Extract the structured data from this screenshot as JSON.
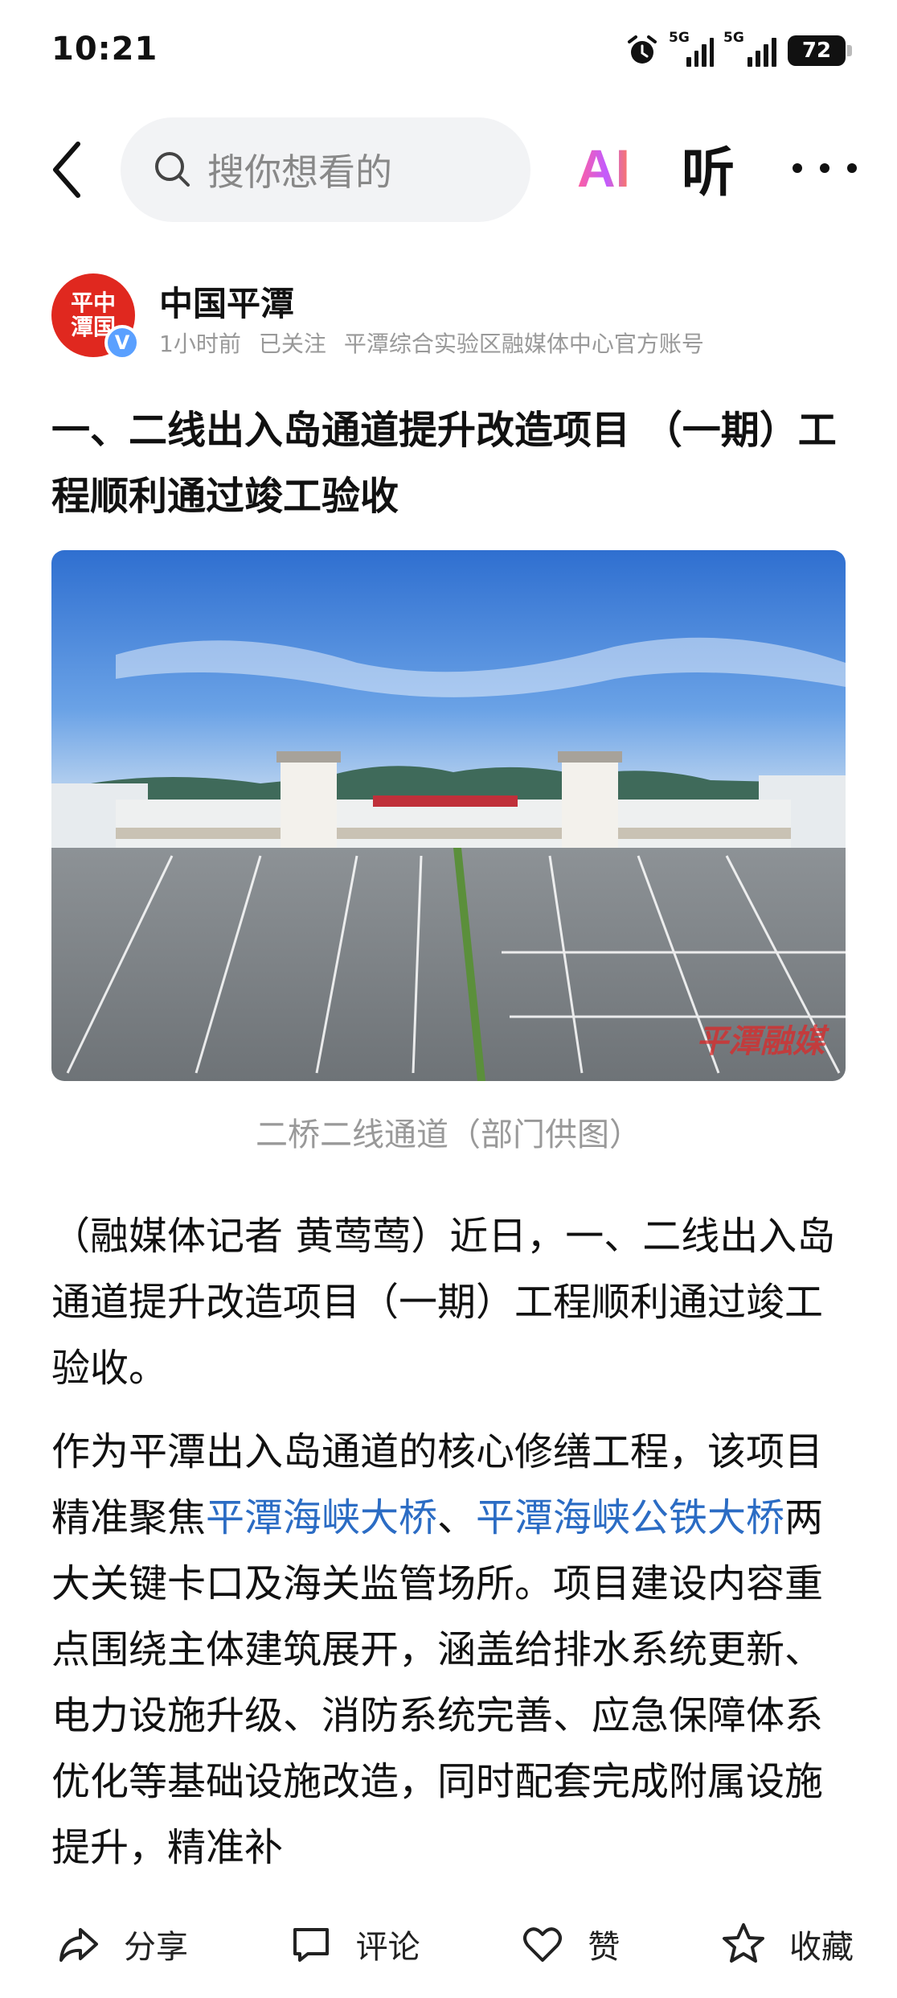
{
  "status_bar": {
    "time": "10:21",
    "net1": "5G",
    "net2": "5G",
    "battery": "72"
  },
  "nav": {
    "search_placeholder": "搜你想看的",
    "ai_label": "AI",
    "listen_label": "听"
  },
  "author": {
    "avatar_logo": "平中潭国",
    "verified_mark": "V",
    "name": "中国平潭",
    "time": "1小时前",
    "follow_status": "已关注",
    "description": "平潭综合实验区融媒体中心官方账号"
  },
  "article": {
    "title": "一、二线出入岛通道提升改造项目 （一期）工程顺利通过竣工验收",
    "photo_watermark": "平潭融媒",
    "caption": "二桥二线通道（部门供图）",
    "p1": "（融媒体记者 黄莺莺）近日，一、二线出入岛通道提升改造项目（一期）工程顺利通过竣工验收。",
    "p2_before": "作为平潭出入岛通道的核心修缮工程，该项目精准聚焦",
    "p2_link1": "平潭海峡大桥",
    "p2_sep": "、",
    "p2_link2": "平潭海峡公铁大桥",
    "p2_after": "两大关键卡口及海关监管场所。项目建设内容重点围绕主体建筑展开，涵盖给排水系统更新、电力设施升级、消防系统完善、应急保障体系优化等基础设施改造，同时配套完成附属设施提升，精准补"
  },
  "bottom_bar": {
    "share": "分享",
    "comment": "评论",
    "like": "赞",
    "favorite": "收藏"
  },
  "colors": {
    "link": "#2b6cc4",
    "avatar_bg": "#e0281f",
    "verified": "#5aa0ff"
  }
}
